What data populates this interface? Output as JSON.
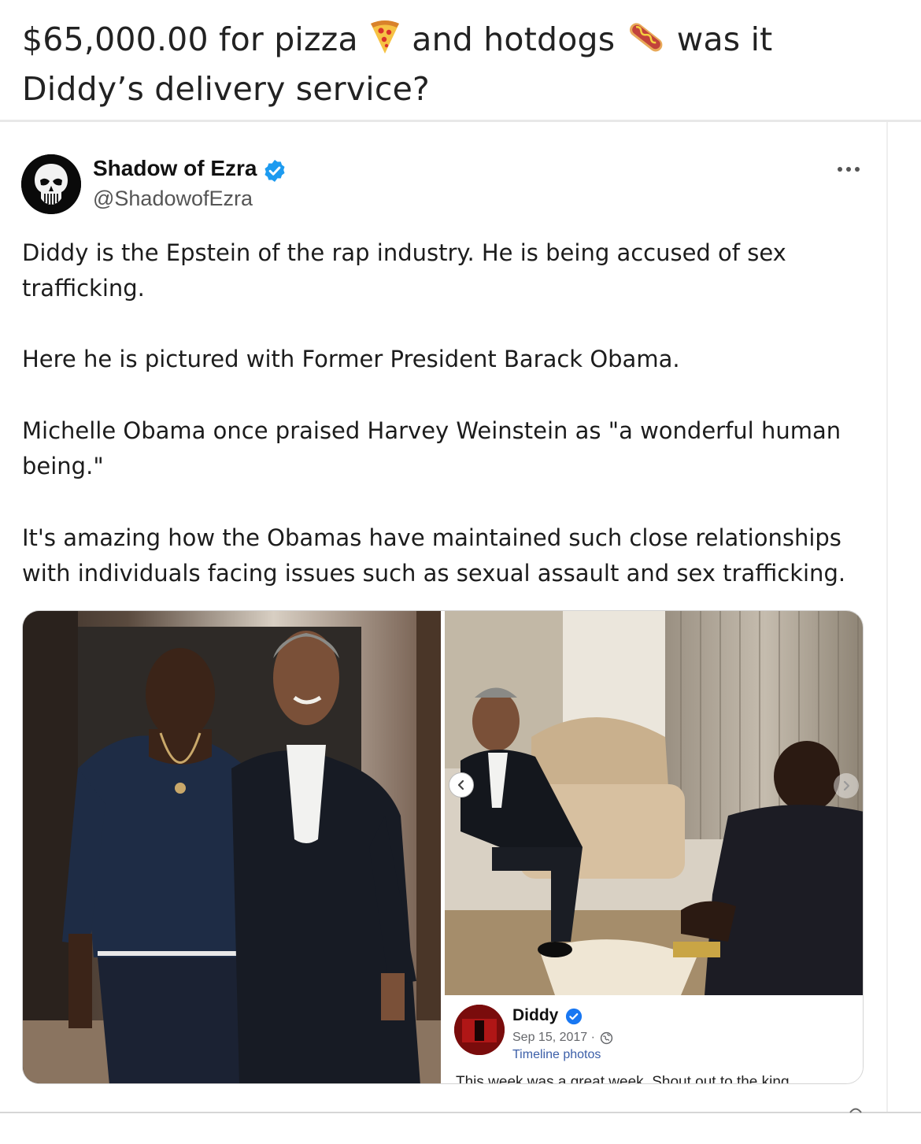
{
  "post": {
    "title_part1": "$65,000.00 for pizza",
    "title_part2": "and hotdogs",
    "title_part3": "was it Diddy’s delivery service?",
    "emoji_1": "pizza-emoji",
    "emoji_2": "hotdog-emoji"
  },
  "tweet": {
    "author_name": "Shadow of Ezra",
    "author_handle": "@ShadowofEzra",
    "verified_color": "#1d9bf0",
    "paragraphs": [
      "Diddy is the Epstein of the rap industry. He is being accused of sex trafficking.",
      "Here he is pictured with Former President Barack Obama.",
      "Michelle Obama once praised Harvey Weinstein as \"a wonderful human being.\"",
      "It's amazing how the Obamas have maintained such close relationships with individuals facing issues such as sexual assault and sex trafficking."
    ]
  },
  "embedded_facebook_post": {
    "name": "Diddy",
    "date": "Sep 15, 2017 ·",
    "album": "Timeline photos",
    "caption_partial": "This week was a great week. Shout out to the king"
  },
  "colors": {
    "accent_link": "#3b5ea8",
    "text_primary": "#1c1c1c",
    "text_secondary": "#555555"
  }
}
